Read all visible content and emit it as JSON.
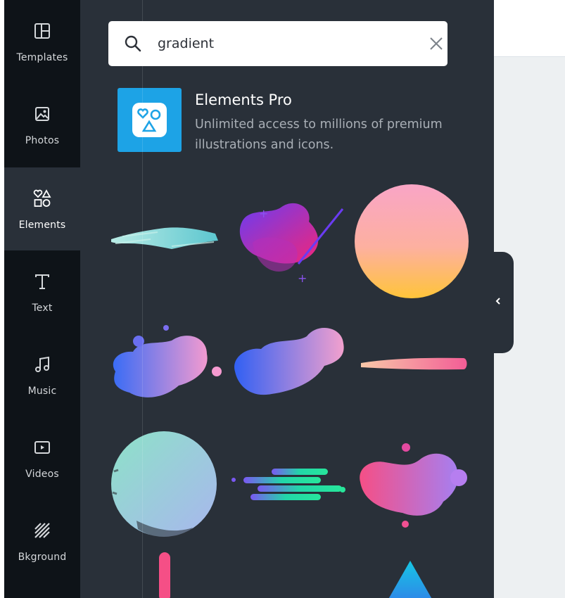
{
  "sidebar": {
    "items": [
      {
        "label": "Templates",
        "icon": "templates-icon",
        "active": false
      },
      {
        "label": "Photos",
        "icon": "photos-icon",
        "active": false
      },
      {
        "label": "Elements",
        "icon": "elements-icon",
        "active": true
      },
      {
        "label": "Text",
        "icon": "text-icon",
        "active": false
      },
      {
        "label": "Music",
        "icon": "music-icon",
        "active": false
      },
      {
        "label": "Videos",
        "icon": "videos-icon",
        "active": false
      },
      {
        "label": "Bkground",
        "icon": "background-icon",
        "active": false
      }
    ]
  },
  "search": {
    "value": "gradient",
    "placeholder": "",
    "icon": "search-icon",
    "clear_icon": "close-icon"
  },
  "promo": {
    "title": "Elements Pro",
    "description": "Unlimited access to millions of premium illustrations and icons.",
    "icon": "elements-pro-icon",
    "color": "#1da3e6"
  },
  "results": {
    "items": [
      {
        "name": "teal-brush-stroke"
      },
      {
        "name": "purple-pink-blob-with-line"
      },
      {
        "name": "pink-yellow-gradient-circle"
      },
      {
        "name": "blue-pink-blob-with-dots"
      },
      {
        "name": "blue-pink-blob"
      },
      {
        "name": "peach-pink-brush-line"
      },
      {
        "name": "teal-grunge-circle"
      },
      {
        "name": "teal-green-speed-lines"
      },
      {
        "name": "pink-purple-blob-with-dots"
      },
      {
        "name": "pink-vertical-bar"
      },
      {
        "name": "blue-triangle"
      }
    ]
  },
  "collapse_handle": {
    "icon": "chevron-left-icon"
  },
  "colors": {
    "sidebar_bg": "#0e1318",
    "panel_bg": "#293039",
    "accent": "#1da3e6"
  }
}
